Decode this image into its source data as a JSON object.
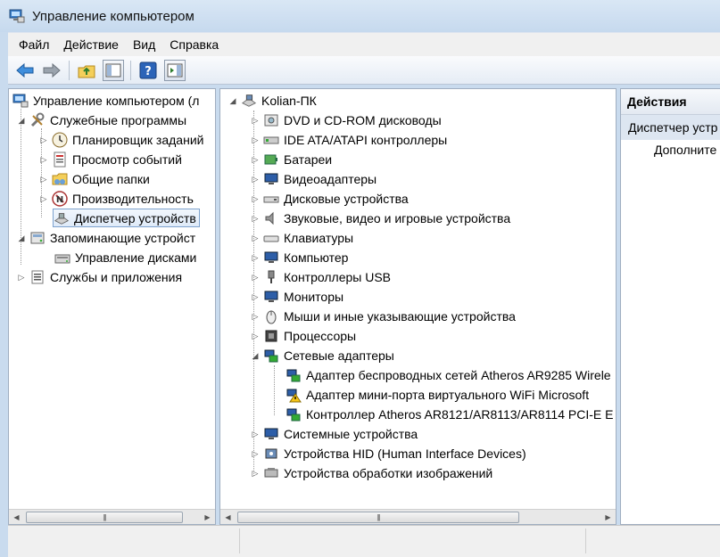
{
  "window": {
    "title": "Управление компьютером"
  },
  "menu": [
    "Файл",
    "Действие",
    "Вид",
    "Справка"
  ],
  "toolbar": [
    "back-arrow-icon",
    "forward-arrow-icon",
    "up-folder-icon",
    "console-tree-icon",
    "help-icon",
    "action-pane-icon"
  ],
  "left_tree": {
    "root": "Управление компьютером (л",
    "utilities": "Служебные программы",
    "task_scheduler": "Планировщик заданий",
    "event_viewer": "Просмотр событий",
    "shared_folders": "Общие папки",
    "performance": "Производительность",
    "device_manager": "Диспетчер устройств",
    "storage": "Запоминающие устройст",
    "disk_management": "Управление дисками",
    "services": "Службы и приложения"
  },
  "device_tree": {
    "computer": "Kolian-ПК",
    "categories": [
      "DVD и CD-ROM дисководы",
      "IDE ATA/ATAPI контроллеры",
      "Батареи",
      "Видеоадаптеры",
      "Дисковые устройства",
      "Звуковые, видео и игровые устройства",
      "Клавиатуры",
      "Компьютер",
      "Контроллеры USB",
      "Мониторы",
      "Мыши и иные указывающие устройства",
      "Процессоры",
      "Сетевые адаптеры"
    ],
    "network_adapters": [
      "Адаптер беспроводных сетей Atheros AR9285 Wirele",
      "Адаптер мини-порта виртуального WiFi Microsoft",
      "Контроллер Atheros AR8121/AR8113/AR8114 PCI-E E"
    ],
    "categories_after": [
      "Системные устройства",
      "Устройства HID (Human Interface Devices)",
      "Устройства обработки изображений"
    ]
  },
  "actions": {
    "header": "Действия",
    "selected": "Диспетчер устр",
    "more": "Дополните"
  },
  "colors": {
    "accent": "#3b79c4",
    "selection": "#dfeaf8",
    "title_bar": "#c6d9ee"
  }
}
